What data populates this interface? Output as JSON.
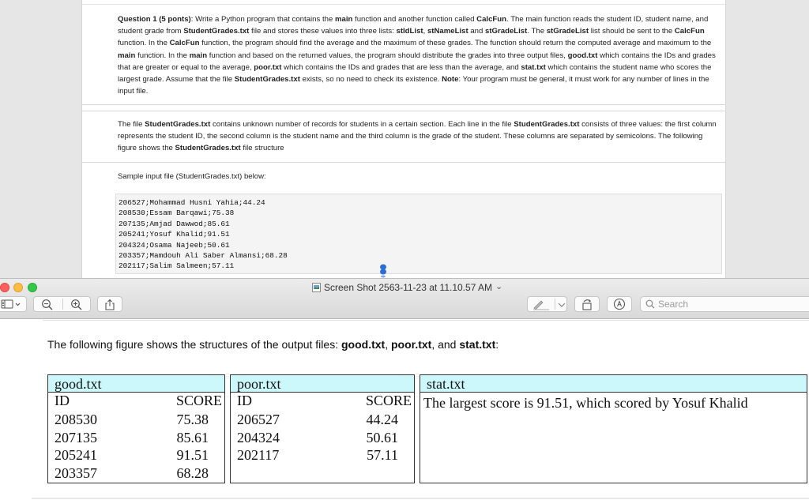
{
  "background_document": {
    "question_title": "Question 1 (5 ponts)",
    "question_body_html": ": Write a Python program that contains the <b>main</b> function and another function called <b>CalcFun</b>. The main function reads the student ID, student name, and student grade from <b>StudentGrades.txt</b> file and stores these values into three lists: <b>stIdList</b>, <b>stNameList</b> and <b>stGradeList</b>. The <b>stGradeList</b> list should be sent to the <b>CalcFun</b> function. In the <b>CalcFun</b> function, the program should find the average and the maximum of these grades. The function should return the computed average and maximum to the <b>main</b> function. In the <b>main</b> function and based on the returned values, the program should distribute the grades into three output files, <b>good.txt</b> which contains the IDs and grades that are greater or equal to the average, <b>poor.txt</b> which contains the IDs and grades that are less than the average, and <b>stat.txt</b> which contains the student name who scores the largest grade. Assume that the file <b>StudentGrades.txt</b> exists, so no need to check its existence. <b>Note</b>: Your program must be general, it must work for any number of lines in the input file.",
    "description_html": "The file <b>StudentGrades.txt</b> contains unknown number of records for students in a certain section. Each line in the file <b>StudentGrades.txt</b> consists of three values: the first column represents the student ID, the second column is the student name and the third column is the grade of the student. These columns are separated by semicolons. The following figure shows the <b>StudentGrades.txt</b> file structure",
    "sample_label": "Sample input file (StudentGrades.txt) below:",
    "code_lines": [
      "206527;Mohammad Husni Yahia;44.24",
      "208530;Essam Barqawi;75.38",
      "207135;Amjad Dawwod;85.61",
      "205241;Yosuf Khalid;91.51",
      "204324;Osama Najeeb;50.61",
      "203357;Mamdouh Ali Saber Almansi;68.28",
      "202117;Salim Salmeen;57.11"
    ]
  },
  "window": {
    "title": "Screen Shot 2563-11-23 at 11.10.57 AM",
    "title_chevron": "⌄",
    "search_placeholder": "Search",
    "colors": {
      "close": "#fc605c",
      "minimize": "#fdbc40",
      "zoom": "#34c84a"
    }
  },
  "preview": {
    "caption_html": "The following figure shows the structures of the output files: <b>good.txt</b>, <b>poor.txt</b>, and <b>stat.txt</b>:",
    "good": {
      "title": "good.txt",
      "col_id": "ID",
      "col_score": "SCORE",
      "rows": [
        {
          "id": "208530",
          "score": "75.38"
        },
        {
          "id": "207135",
          "score": "85.61"
        },
        {
          "id": "205241",
          "score": "91.51"
        },
        {
          "id": "203357",
          "score": "68.28"
        }
      ]
    },
    "poor": {
      "title": "poor.txt",
      "col_id": "ID",
      "col_score": "SCORE",
      "rows": [
        {
          "id": "206527",
          "score": "44.24"
        },
        {
          "id": "204324",
          "score": "50.61"
        },
        {
          "id": "202117",
          "score": "57.11"
        }
      ]
    },
    "stat": {
      "title": "stat.txt",
      "text": "The largest score is 91.51, which scored by  Yosuf Khalid"
    },
    "header_color": "#ccf8fb"
  }
}
